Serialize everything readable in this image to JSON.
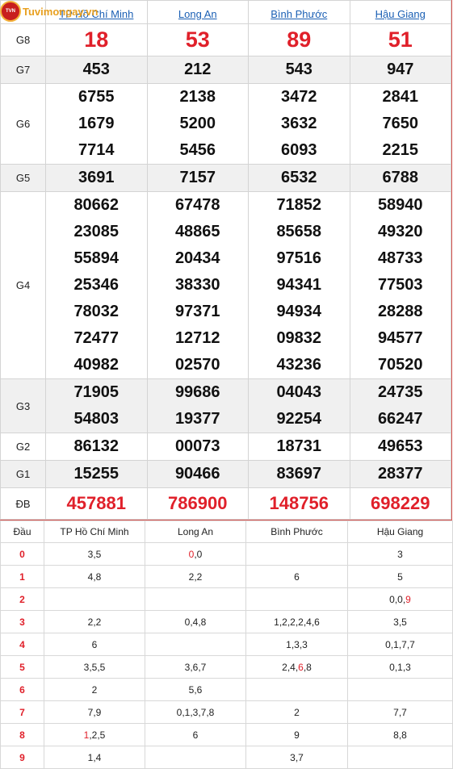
{
  "brand": {
    "logo_text": "Tuvimongay.vn",
    "logo_badge": "TVN"
  },
  "results": {
    "provinces": [
      "TP Hồ Chí Minh",
      "Long An",
      "Bình Phước",
      "Hậu Giang"
    ],
    "rows": [
      {
        "label": "G8",
        "values": [
          [
            "18"
          ],
          [
            "53"
          ],
          [
            "89"
          ],
          [
            "51"
          ]
        ]
      },
      {
        "label": "G7",
        "values": [
          [
            "453"
          ],
          [
            "212"
          ],
          [
            "543"
          ],
          [
            "947"
          ]
        ]
      },
      {
        "label": "G6",
        "values": [
          [
            "6755",
            "1679",
            "7714"
          ],
          [
            "2138",
            "5200",
            "5456"
          ],
          [
            "3472",
            "3632",
            "6093"
          ],
          [
            "2841",
            "7650",
            "2215"
          ]
        ]
      },
      {
        "label": "G5",
        "values": [
          [
            "3691"
          ],
          [
            "7157"
          ],
          [
            "6532"
          ],
          [
            "6788"
          ]
        ]
      },
      {
        "label": "G4",
        "values": [
          [
            "80662",
            "23085",
            "55894",
            "25346",
            "78032",
            "72477",
            "40982"
          ],
          [
            "67478",
            "48865",
            "20434",
            "38330",
            "97371",
            "12712",
            "02570"
          ],
          [
            "71852",
            "85658",
            "97516",
            "94341",
            "94934",
            "09832",
            "43236"
          ],
          [
            "58940",
            "49320",
            "48733",
            "77503",
            "28288",
            "94577",
            "70520"
          ]
        ]
      },
      {
        "label": "G3",
        "values": [
          [
            "71905",
            "54803"
          ],
          [
            "99686",
            "19377"
          ],
          [
            "04043",
            "92254"
          ],
          [
            "24735",
            "66247"
          ]
        ]
      },
      {
        "label": "G2",
        "values": [
          [
            "86132"
          ],
          [
            "00073"
          ],
          [
            "18731"
          ],
          [
            "49653"
          ]
        ]
      },
      {
        "label": "G1",
        "values": [
          [
            "15255"
          ],
          [
            "90466"
          ],
          [
            "83697"
          ],
          [
            "28377"
          ]
        ]
      },
      {
        "label": "ĐB",
        "values": [
          [
            "457881"
          ],
          [
            "786900"
          ],
          [
            "148756"
          ],
          [
            "698229"
          ]
        ]
      }
    ]
  },
  "loto": {
    "header": [
      "Đầu",
      "TP Hồ Chí Minh",
      "Long An",
      "Bình Phước",
      "Hậu Giang"
    ],
    "rows": [
      {
        "dau": "0",
        "cells": [
          [
            {
              "t": "3,5"
            }
          ],
          [
            {
              "t": "0",
              "red": true
            },
            {
              "t": ",0"
            }
          ],
          [],
          [
            {
              "t": "3"
            }
          ]
        ]
      },
      {
        "dau": "1",
        "cells": [
          [
            {
              "t": "4,8"
            }
          ],
          [
            {
              "t": "2,2"
            }
          ],
          [
            {
              "t": "6"
            }
          ],
          [
            {
              "t": "5"
            }
          ]
        ]
      },
      {
        "dau": "2",
        "cells": [
          [],
          [],
          [],
          [
            {
              "t": "0,0,"
            },
            {
              "t": "9",
              "red": true
            }
          ]
        ]
      },
      {
        "dau": "3",
        "cells": [
          [
            {
              "t": "2,2"
            }
          ],
          [
            {
              "t": "0,4,8"
            }
          ],
          [
            {
              "t": "1,2,2,2,4,6"
            }
          ],
          [
            {
              "t": "3,5"
            }
          ]
        ]
      },
      {
        "dau": "4",
        "cells": [
          [
            {
              "t": "6"
            }
          ],
          [],
          [
            {
              "t": "1,3,3"
            }
          ],
          [
            {
              "t": "0,1,7,7"
            }
          ]
        ]
      },
      {
        "dau": "5",
        "cells": [
          [
            {
              "t": "3,5,5"
            }
          ],
          [
            {
              "t": "3,6,7"
            }
          ],
          [
            {
              "t": "2,4,"
            },
            {
              "t": "6",
              "red": true
            },
            {
              "t": ",8"
            }
          ],
          [
            {
              "t": "0,1,3"
            }
          ]
        ]
      },
      {
        "dau": "6",
        "cells": [
          [
            {
              "t": "2"
            }
          ],
          [
            {
              "t": "5,6"
            }
          ],
          [],
          []
        ]
      },
      {
        "dau": "7",
        "cells": [
          [
            {
              "t": "7,9"
            }
          ],
          [
            {
              "t": "0,1,3,7,8"
            }
          ],
          [
            {
              "t": "2"
            }
          ],
          [
            {
              "t": "7,7"
            }
          ]
        ]
      },
      {
        "dau": "8",
        "cells": [
          [
            {
              "t": "1",
              "red": true
            },
            {
              "t": ",2,5"
            }
          ],
          [
            {
              "t": "6"
            }
          ],
          [
            {
              "t": "9"
            }
          ],
          [
            {
              "t": "8,8"
            }
          ]
        ]
      },
      {
        "dau": "9",
        "cells": [
          [
            {
              "t": "1,4"
            }
          ],
          [],
          [
            {
              "t": "3,7"
            }
          ],
          []
        ]
      }
    ]
  },
  "colors": {
    "accent_red": "#e0202a",
    "link_blue": "#1a5fb4",
    "row_alt": "#f0f0f0"
  }
}
